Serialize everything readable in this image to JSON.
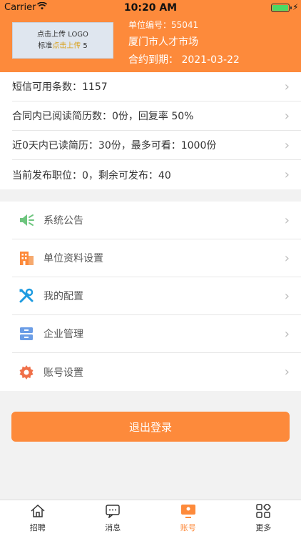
{
  "status_bar": {
    "carrier": "Carrier",
    "time": "10:20 AM"
  },
  "header": {
    "logo_line1": "点击上传 LOGO",
    "logo_line2_a": "标准",
    "logo_line2_b": "点击上传",
    "logo_line2_c": "5",
    "unit_id": "单位编号：55041",
    "unit_name": "厦门市人才市场",
    "contract_expiry": "合约到期：  2021-03-22"
  },
  "stats": [
    "短信可用条数：1157",
    "合同内已阅读简历数：0份，回复率 50%",
    "近0天内已读简历：30份，最多可看：1000份",
    "当前发布职位：0，剩余可发布：40"
  ],
  "menu": [
    {
      "label": "系统公告",
      "icon": "speaker-icon"
    },
    {
      "label": "单位资料设置",
      "icon": "building-icon"
    },
    {
      "label": "我的配置",
      "icon": "tools-icon"
    },
    {
      "label": "企业管理",
      "icon": "cabinet-icon"
    },
    {
      "label": "账号设置",
      "icon": "gear-icon"
    }
  ],
  "logout_label": "退出登录",
  "tabs": [
    {
      "label": "招聘",
      "icon": "home-icon"
    },
    {
      "label": "消息",
      "icon": "message-icon"
    },
    {
      "label": "账号",
      "icon": "account-icon"
    },
    {
      "label": "更多",
      "icon": "grid-icon"
    }
  ],
  "colors": {
    "accent": "#fd8a3b"
  }
}
